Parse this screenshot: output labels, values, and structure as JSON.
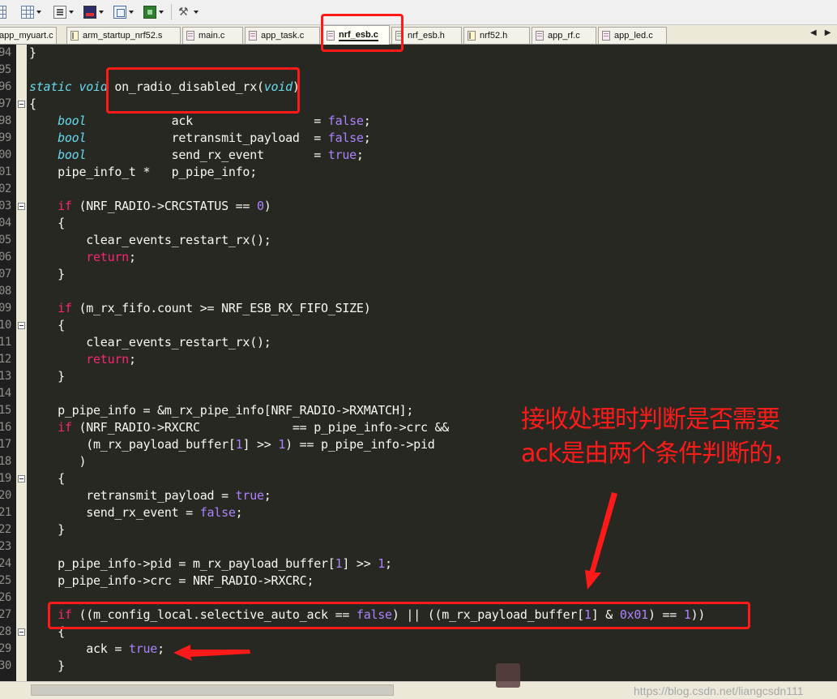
{
  "toolbar": {
    "buttons": [
      {
        "icon": "page-icon"
      },
      {
        "icon": "grid-view-icon"
      },
      {
        "icon": "edit-icon"
      },
      {
        "icon": "chart-icon"
      },
      {
        "icon": "window-icon"
      },
      {
        "icon": "chip-icon"
      },
      {
        "icon": "tools-icon"
      }
    ]
  },
  "tabs": [
    {
      "label": "app_myuart.c",
      "icon": "c-file-icon",
      "active": false
    },
    {
      "label": "arm_startup_nrf52.s",
      "icon": "asm-file-icon",
      "active": false
    },
    {
      "label": "main.c",
      "icon": "c-file-icon",
      "active": false
    },
    {
      "label": "app_task.c",
      "icon": "c-file-icon",
      "active": false
    },
    {
      "label": "nrf_esb.c",
      "icon": "c-file-icon",
      "active": true
    },
    {
      "label": "nrf_esb.h",
      "icon": "h-file-icon",
      "active": false
    },
    {
      "label": "nrf52.h",
      "icon": "asm-file-icon",
      "active": false
    },
    {
      "label": "app_rf.c",
      "icon": "c-file-icon",
      "active": false
    },
    {
      "label": "app_led.c",
      "icon": "c-file-icon",
      "active": false
    }
  ],
  "code_lines": [
    {
      "ln": "94",
      "fold": false,
      "html": "}"
    },
    {
      "ln": "95",
      "fold": false,
      "html": ""
    },
    {
      "ln": "96",
      "fold": false,
      "html": "<span class='ty'>static void</span> on_radio_disabled_rx(<span class='ty'>void</span>)"
    },
    {
      "ln": "97",
      "fold": true,
      "html": "{"
    },
    {
      "ln": "98",
      "fold": false,
      "html": "    <span class='ty'>bool</span>            ack                 = <span class='cst'>false</span>;"
    },
    {
      "ln": "99",
      "fold": false,
      "html": "    <span class='ty'>bool</span>            retransmit_payload  = <span class='cst'>false</span>;"
    },
    {
      "ln": "00",
      "fold": false,
      "html": "    <span class='ty'>bool</span>            send_rx_event       = <span class='cst'>true</span>;"
    },
    {
      "ln": "01",
      "fold": false,
      "html": "    pipe_info_t *   p_pipe_info;"
    },
    {
      "ln": "02",
      "fold": false,
      "html": ""
    },
    {
      "ln": "03",
      "fold": true,
      "html": "    <span class='kw'>if</span> (NRF_RADIO->CRCSTATUS == <span class='cst'>0</span>)"
    },
    {
      "ln": "04",
      "fold": false,
      "html": "    {"
    },
    {
      "ln": "05",
      "fold": false,
      "html": "        clear_events_restart_rx();"
    },
    {
      "ln": "06",
      "fold": false,
      "html": "        <span class='kw'>return</span>;"
    },
    {
      "ln": "07",
      "fold": false,
      "html": "    }"
    },
    {
      "ln": "08",
      "fold": false,
      "html": ""
    },
    {
      "ln": "09",
      "fold": false,
      "html": "    <span class='kw'>if</span> (m_rx_fifo.count >= NRF_ESB_RX_FIFO_SIZE)"
    },
    {
      "ln": "10",
      "fold": true,
      "html": "    {"
    },
    {
      "ln": "11",
      "fold": false,
      "html": "        clear_events_restart_rx();"
    },
    {
      "ln": "12",
      "fold": false,
      "html": "        <span class='kw'>return</span>;"
    },
    {
      "ln": "13",
      "fold": false,
      "html": "    }"
    },
    {
      "ln": "14",
      "fold": false,
      "html": ""
    },
    {
      "ln": "15",
      "fold": false,
      "html": "    p_pipe_info = &m_rx_pipe_info[NRF_RADIO->RXMATCH];"
    },
    {
      "ln": "16",
      "fold": false,
      "html": "    <span class='kw'>if</span> (NRF_RADIO->RXCRC             == p_pipe_info->crc &&"
    },
    {
      "ln": "17",
      "fold": false,
      "html": "        (m_rx_payload_buffer[<span class='cst'>1</span>] >> <span class='cst'>1</span>) == p_pipe_info->pid"
    },
    {
      "ln": "18",
      "fold": false,
      "html": "       )"
    },
    {
      "ln": "19",
      "fold": true,
      "html": "    {"
    },
    {
      "ln": "20",
      "fold": false,
      "html": "        retransmit_payload = <span class='cst'>true</span>;"
    },
    {
      "ln": "21",
      "fold": false,
      "html": "        send_rx_event = <span class='cst'>false</span>;"
    },
    {
      "ln": "22",
      "fold": false,
      "html": "    }"
    },
    {
      "ln": "23",
      "fold": false,
      "html": ""
    },
    {
      "ln": "24",
      "fold": false,
      "html": "    p_pipe_info->pid = m_rx_payload_buffer[<span class='cst'>1</span>] >> <span class='cst'>1</span>;"
    },
    {
      "ln": "25",
      "fold": false,
      "html": "    p_pipe_info->crc = NRF_RADIO->RXCRC;"
    },
    {
      "ln": "26",
      "fold": false,
      "html": ""
    },
    {
      "ln": "27",
      "fold": false,
      "html": "    <span class='kw'>if</span> ((m_config_local.selective_auto_ack == <span class='cst'>false</span>) || ((m_rx_payload_buffer[<span class='cst'>1</span>] &amp; <span class='cst'>0x01</span>) == <span class='cst'>1</span>))"
    },
    {
      "ln": "28",
      "fold": true,
      "html": "    {"
    },
    {
      "ln": "29",
      "fold": false,
      "html": "        ack = <span class='cst'>true</span>;"
    },
    {
      "ln": "30",
      "fold": false,
      "html": "    }"
    }
  ],
  "annotation": {
    "note_line1": "接收处理时判断是否需要",
    "note_line2": "ack是由两个条件判断的，",
    "color": "#ff1a1a"
  },
  "watermark": "https://blog.csdn.net/liangcsdn111",
  "theme": {
    "editor_bg": "#272822",
    "keyword": "#f92672",
    "type": "#66d9ef",
    "constant": "#ae81ff",
    "text": "#f8f8f2"
  }
}
